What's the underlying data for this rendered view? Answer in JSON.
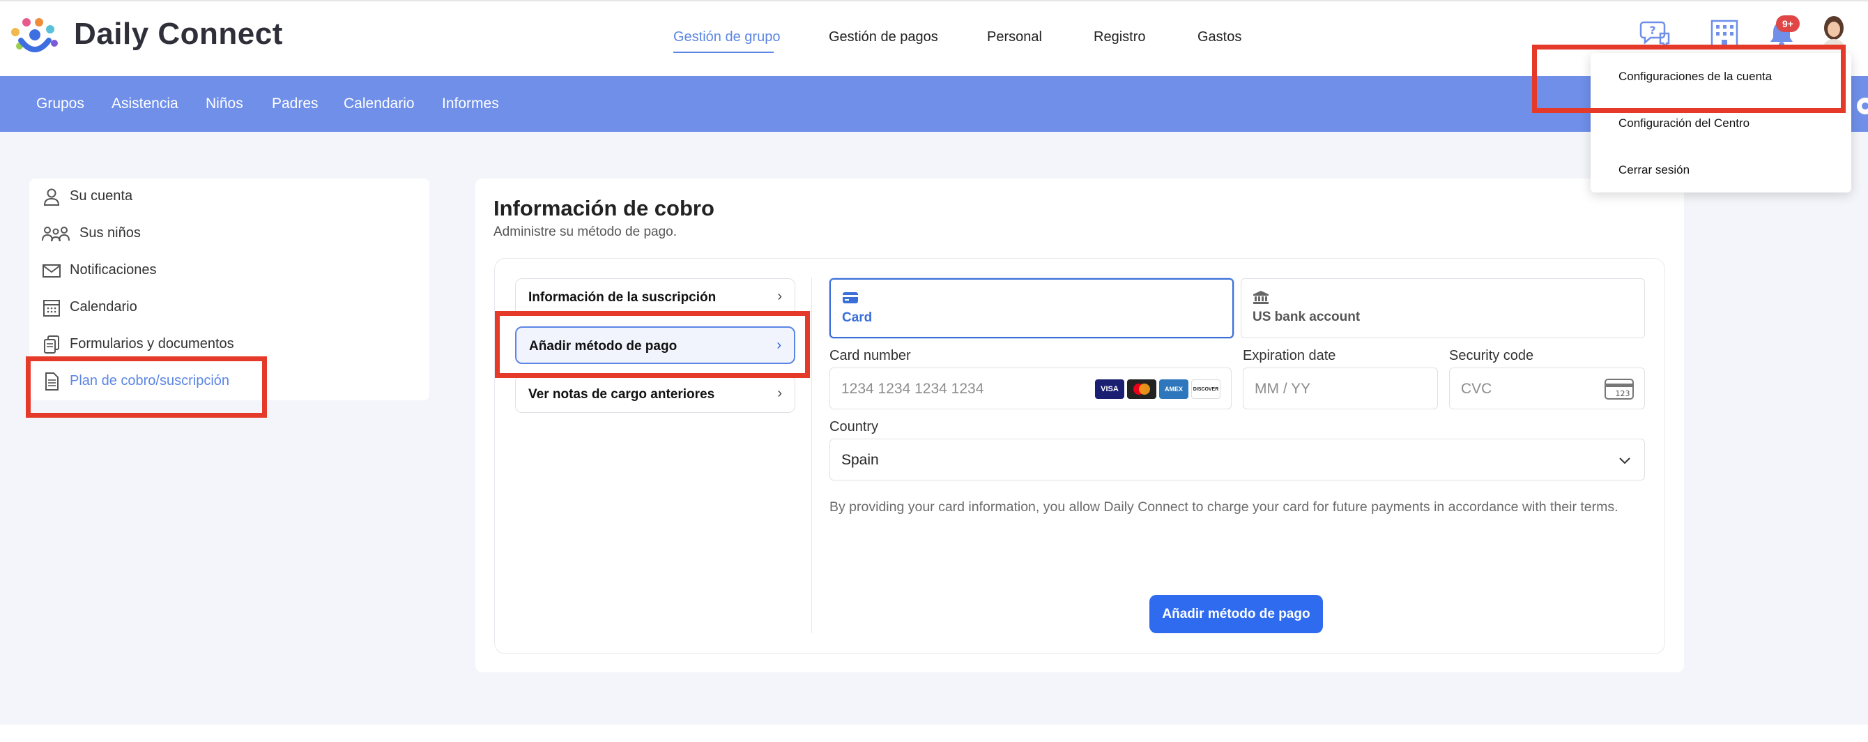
{
  "brand": {
    "name": "Daily Connect"
  },
  "topnav": {
    "items": [
      {
        "label": "Gestión de grupo",
        "active": true
      },
      {
        "label": "Gestión de pagos"
      },
      {
        "label": "Personal"
      },
      {
        "label": "Registro"
      },
      {
        "label": "Gastos"
      }
    ],
    "notifications_badge": "9+"
  },
  "subnav": {
    "items": [
      "Grupos",
      "Asistencia",
      "Niños",
      "Padres",
      "Calendario",
      "Informes"
    ]
  },
  "account_menu": {
    "items": [
      "Su cuenta",
      "Sus niños",
      "Notificaciones",
      "Calendario",
      "Formularios y documentos",
      "Plan de cobro/suscripción"
    ],
    "active": "Plan de cobro/suscripción"
  },
  "billing": {
    "title": "Información de cobro",
    "subtitle": "Administre su método de pago.",
    "tabs": [
      {
        "label": "Información de la suscripción",
        "chevron": "›"
      },
      {
        "label": "Añadir método de pago",
        "chevron": "›",
        "active": true
      },
      {
        "label": "Ver notas de cargo anteriores",
        "chevron": "›"
      }
    ]
  },
  "payment": {
    "methods": [
      {
        "label": "Card",
        "icon": "card-icon",
        "selected": true
      },
      {
        "label": "US bank account",
        "icon": "bank-icon"
      }
    ],
    "card_number": {
      "label": "Card number",
      "placeholder": "1234 1234 1234 1234",
      "brands": [
        "VISA",
        "mastercard",
        "AMEX",
        "DISCOVER"
      ]
    },
    "expiry": {
      "label": "Expiration date",
      "placeholder": "MM / YY"
    },
    "cvc": {
      "label": "Security code",
      "placeholder": "CVC",
      "icon_text": "123"
    },
    "country": {
      "label": "Country",
      "value": "Spain",
      "icon": "chevron-down-icon"
    },
    "disclaimer": "By providing your card information, you allow Daily Connect to charge your card for future payments in accordance with their terms.",
    "submit_label": "Añadir método de pago"
  },
  "dropdown": {
    "items": [
      "Configuraciones de la cuenta",
      "Configuración del Centro",
      "Cerrar sesión"
    ]
  },
  "colors": {
    "accent": "#5b86e5",
    "nav_bar": "#6f8fe9",
    "primary_button": "#2f6bef",
    "highlight": "#e53a2a",
    "badge": "#e04646"
  }
}
